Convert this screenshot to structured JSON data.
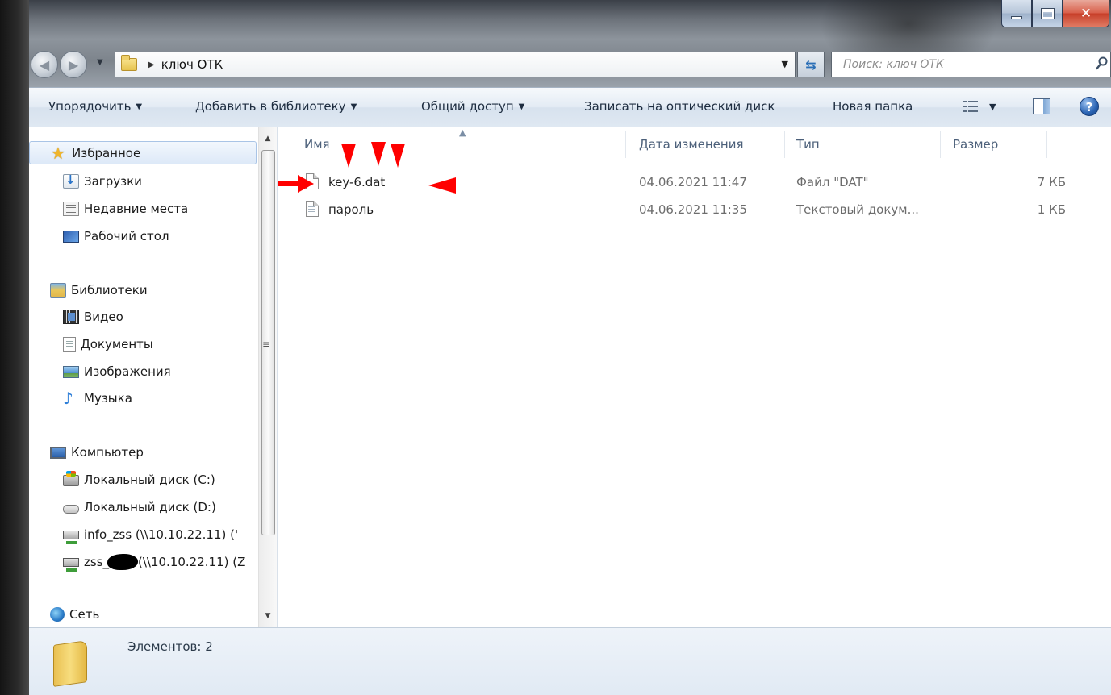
{
  "address": {
    "path": "ключ ОТК"
  },
  "search": {
    "placeholder": "Поиск: ключ ОТК"
  },
  "toolbar": {
    "organize": "Упорядочить",
    "add_to_library": "Добавить в библиотеку",
    "share": "Общий доступ",
    "burn": "Записать на оптический диск",
    "new_folder": "Новая папка",
    "help": "?"
  },
  "sidebar": {
    "favorites": "Избранное",
    "downloads": "Загрузки",
    "recent": "Недавние места",
    "desktop": "Рабочий стол",
    "libraries": "Библиотеки",
    "video": "Видео",
    "documents": "Документы",
    "images": "Изображения",
    "music": "Музыка",
    "computer": "Компьютер",
    "disk_c": "Локальный диск (C:)",
    "disk_d": "Локальный диск (D:)",
    "net1": "info_zss (\\\\10.10.22.11) ('",
    "net2_prefix": "zss_",
    "net2_suffix": "(\\\\10.10.22.11) (Z",
    "network": "Сеть"
  },
  "columns": {
    "name": "Имя",
    "date": "Дата изменения",
    "type": "Тип",
    "size": "Размер"
  },
  "files": [
    {
      "name": "key-6.dat",
      "date": "04.06.2021 11:47",
      "type": "Файл \"DAT\"",
      "size": "7 КБ"
    },
    {
      "name": "пароль",
      "date": "04.06.2021 11:35",
      "type": "Текстовый докум...",
      "size": "1 КБ"
    }
  ],
  "status": {
    "count": "Элементов: 2"
  },
  "colors": {
    "annotation": "#ff0000",
    "header_text": "#4c607a",
    "toolbar_text": "#1e2d40"
  },
  "icons": {
    "favorites": "star-icon",
    "downloads": "downloads-folder-icon",
    "recent": "recent-places-icon",
    "desktop": "desktop-icon",
    "libraries": "library-icon",
    "video": "video-icon",
    "documents": "documents-icon",
    "images": "images-icon",
    "music": "music-note-icon",
    "computer": "computer-icon",
    "disk": "hard-disk-icon",
    "netdrive": "network-drive-icon",
    "network": "network-icon",
    "file": "file-icon"
  }
}
